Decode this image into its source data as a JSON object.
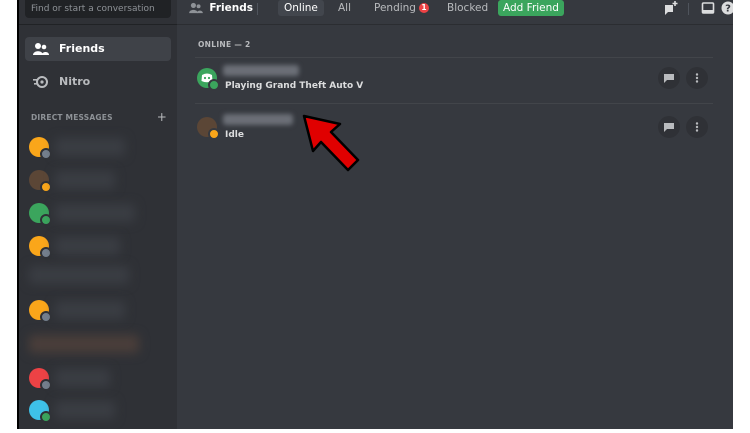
{
  "search": {
    "placeholder": "Find or start a conversation"
  },
  "sidebar": {
    "items": [
      {
        "label": "Friends",
        "icon": "friends-icon"
      },
      {
        "label": "Nitro",
        "icon": "nitro-icon"
      }
    ],
    "dm_header": "DIRECT MESSAGES",
    "dm_add": "+"
  },
  "topbar": {
    "friends_label": "Friends",
    "tabs": [
      {
        "label": "Online"
      },
      {
        "label": "All"
      },
      {
        "label": "Pending"
      },
      {
        "label": "Blocked"
      }
    ],
    "pending_badge": "1",
    "add_friend": "Add Friend"
  },
  "friends": {
    "header": "ONLINE — 2",
    "rows": [
      {
        "status": "Playing Grand Theft Auto V"
      },
      {
        "status": "Idle"
      }
    ]
  },
  "colors": {
    "accent_green": "#3ba55d",
    "red_badge": "#ed4245",
    "arrow": "#e00000"
  }
}
